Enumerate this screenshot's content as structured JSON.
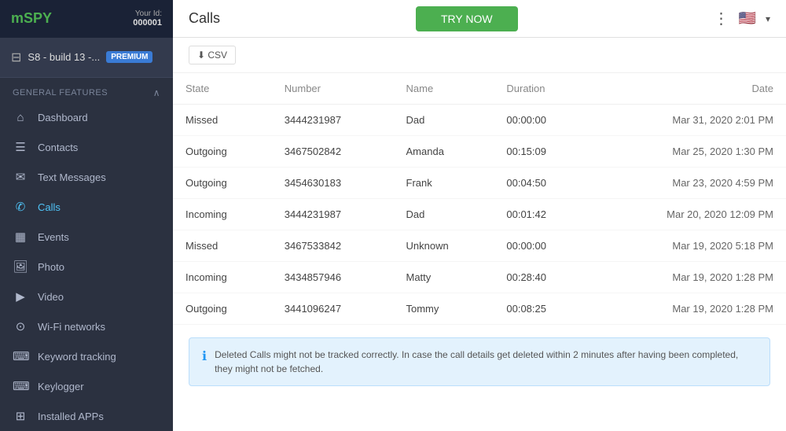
{
  "sidebar": {
    "logo": "mSPY",
    "logo_accent": "m",
    "user_id_label": "Your Id:",
    "user_id": "000001",
    "device_name": "S8 - build 13 -...",
    "premium_badge": "PREMIUM",
    "general_features_label": "GENERAL FEATURES",
    "nav_items": [
      {
        "id": "dashboard",
        "label": "Dashboard",
        "icon": "⌂",
        "active": false
      },
      {
        "id": "contacts",
        "label": "Contacts",
        "icon": "☰",
        "active": false
      },
      {
        "id": "text-messages",
        "label": "Text Messages",
        "icon": "✉",
        "active": false
      },
      {
        "id": "calls",
        "label": "Calls",
        "icon": "✆",
        "active": true
      },
      {
        "id": "events",
        "label": "Events",
        "icon": "▦",
        "active": false
      },
      {
        "id": "photo",
        "label": "Photo",
        "icon": "🖼",
        "active": false
      },
      {
        "id": "video",
        "label": "Video",
        "icon": "▶",
        "active": false
      },
      {
        "id": "wifi",
        "label": "Wi-Fi networks",
        "icon": "⊙",
        "active": false
      },
      {
        "id": "keyword",
        "label": "Keyword tracking",
        "icon": "⌨",
        "active": false
      },
      {
        "id": "keylogger",
        "label": "Keylogger",
        "icon": "⌨",
        "active": false
      },
      {
        "id": "installed-apps",
        "label": "Installed APPs",
        "icon": "⊞",
        "active": false
      }
    ]
  },
  "topbar": {
    "title": "Calls",
    "try_now_label": "TRY NOW",
    "flag": "🇺🇸"
  },
  "table": {
    "headers": [
      "State",
      "Number",
      "Name",
      "Duration",
      "Date"
    ],
    "rows": [
      {
        "state": "Missed",
        "number": "3444231987",
        "name": "Dad",
        "duration": "00:00:00",
        "date": "Mar 31, 2020 2:01 PM"
      },
      {
        "state": "Outgoing",
        "number": "3467502842",
        "name": "Amanda",
        "duration": "00:15:09",
        "date": "Mar 25, 2020 1:30 PM"
      },
      {
        "state": "Outgoing",
        "number": "3454630183",
        "name": "Frank",
        "duration": "00:04:50",
        "date": "Mar 23, 2020 4:59 PM"
      },
      {
        "state": "Incoming",
        "number": "3444231987",
        "name": "Dad",
        "duration": "00:01:42",
        "date": "Mar 20, 2020 12:09 PM"
      },
      {
        "state": "Missed",
        "number": "3467533842",
        "name": "Unknown",
        "duration": "00:00:00",
        "date": "Mar 19, 2020 5:18 PM"
      },
      {
        "state": "Incoming",
        "number": "3434857946",
        "name": "Matty",
        "duration": "00:28:40",
        "date": "Mar 19, 2020 1:28 PM"
      },
      {
        "state": "Outgoing",
        "number": "3441096247",
        "name": "Tommy",
        "duration": "00:08:25",
        "date": "Mar 19, 2020 1:28 PM"
      }
    ]
  },
  "info_text": "Deleted Calls might not be tracked correctly. In case the call details get deleted within 2 minutes after having been completed, they might not be fetched."
}
